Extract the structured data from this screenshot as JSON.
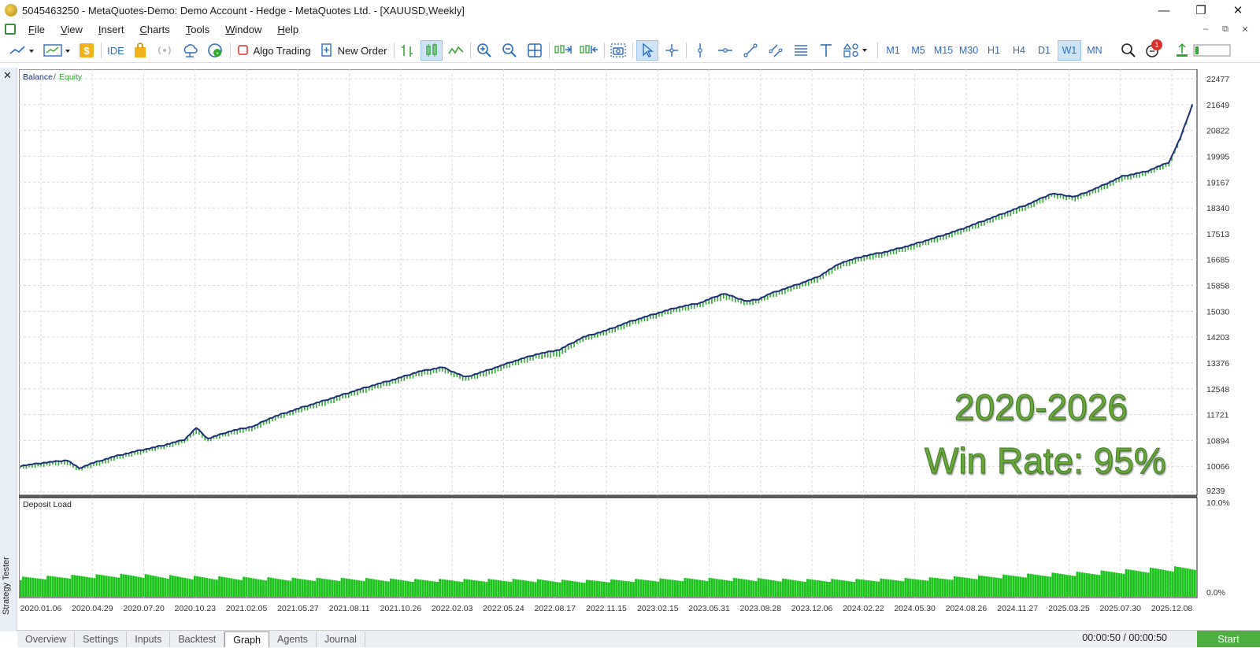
{
  "window": {
    "title": "5045463250 - MetaQuotes-Demo: Demo Account - Hedge - MetaQuotes Ltd. - [XAUUSD,Weekly]",
    "minimize": "—",
    "maximize": "❐",
    "close": "✕"
  },
  "menu": {
    "items": [
      "File",
      "View",
      "Insert",
      "Charts",
      "Tools",
      "Window",
      "Help"
    ],
    "mdi_minimize": "–",
    "mdi_restore": "⧉",
    "mdi_close": "✕"
  },
  "toolbar": {
    "ide_label": "IDE",
    "algo_trading_label": "Algo Trading",
    "new_order_label": "New Order",
    "timeframes": [
      "M1",
      "M5",
      "M15",
      "M30",
      "H1",
      "H4",
      "D1",
      "W1",
      "MN"
    ],
    "selected_timeframe": "W1",
    "notification_count": "1"
  },
  "panel": {
    "close_label": "✕",
    "side_label": "Strategy Tester",
    "overlay_line1": "2020-2026",
    "overlay_line2": "Win Rate: 95%"
  },
  "chart_data": [
    {
      "type": "line",
      "legend": [
        {
          "name": "Balance",
          "color": "#1c2f7a"
        },
        {
          "name": "Equity",
          "color": "#2fa82f"
        }
      ],
      "legend_separator": "/",
      "ylim": [
        9239,
        22477
      ],
      "y_ticks": [
        "22477",
        "21649",
        "20822",
        "19995",
        "19167",
        "18340",
        "17513",
        "16685",
        "15858",
        "15030",
        "14203",
        "13376",
        "12548",
        "11721",
        "10894",
        "10066",
        "9239"
      ],
      "x_ticks": [
        "2020.01.06",
        "2020.04.29",
        "2020.07.20",
        "2020.10.23",
        "2021.02.05",
        "2021.05.27",
        "2021.08.11",
        "2021.10.26",
        "2022.02.03",
        "2022.05.24",
        "2022.08.17",
        "2022.11.15",
        "2023.02.15",
        "2023.05.31",
        "2023.08.28",
        "2023.12.06",
        "2024.02.22",
        "2024.05.30",
        "2024.08.26",
        "2024.11.27",
        "2025.03.25",
        "2025.07.30",
        "2025.12.08"
      ],
      "series": [
        {
          "name": "Balance",
          "x": [
            0,
            2,
            4,
            5,
            6,
            8,
            10,
            12,
            14,
            15,
            16,
            17,
            18,
            20,
            21,
            22,
            24,
            26,
            28,
            30,
            32,
            34,
            36,
            38,
            40,
            42,
            44,
            46,
            48,
            50,
            52,
            54,
            56,
            58,
            60,
            62,
            63,
            64,
            66,
            68,
            69,
            70,
            72,
            74,
            76,
            78,
            80,
            82,
            84,
            86,
            88,
            90,
            92,
            94,
            96,
            98,
            99,
            100
          ],
          "values": [
            10080,
            10180,
            10260,
            10000,
            10150,
            10380,
            10560,
            10720,
            10920,
            11300,
            10950,
            11080,
            11200,
            11360,
            11560,
            11700,
            11950,
            12180,
            12420,
            12650,
            12860,
            13100,
            13240,
            12920,
            13160,
            13420,
            13650,
            13800,
            14200,
            14420,
            14700,
            14930,
            15150,
            15300,
            15600,
            15350,
            15420,
            15600,
            15850,
            16120,
            16350,
            16580,
            16800,
            16950,
            17150,
            17380,
            17620,
            17900,
            18180,
            18460,
            18800,
            18700,
            19000,
            19350,
            19500,
            19800,
            20600,
            21649
          ]
        },
        {
          "name": "Equity",
          "x": [
            0,
            2,
            4,
            5,
            6,
            8,
            10,
            12,
            14,
            15,
            16,
            17,
            18,
            20,
            21,
            22,
            24,
            26,
            28,
            30,
            32,
            34,
            36,
            38,
            40,
            42,
            44,
            46,
            48,
            50,
            52,
            54,
            56,
            58,
            60,
            62,
            63,
            64,
            66,
            68,
            69,
            70,
            72,
            74,
            76,
            78,
            80,
            82,
            84,
            86,
            88,
            90,
            92,
            94,
            96,
            98,
            99,
            100
          ],
          "values": [
            10000,
            10100,
            10150,
            9950,
            10050,
            10280,
            10470,
            10640,
            10830,
            11150,
            10880,
            11000,
            11100,
            11250,
            11450,
            11600,
            11850,
            12050,
            12300,
            12530,
            12750,
            12980,
            13120,
            12820,
            13020,
            13300,
            13520,
            13620,
            14100,
            14300,
            14580,
            14820,
            15030,
            15180,
            15450,
            15250,
            15320,
            15480,
            15730,
            16000,
            16220,
            16450,
            16680,
            16830,
            17030,
            17260,
            17500,
            17780,
            18060,
            18330,
            18700,
            18600,
            18880,
            19230,
            19400,
            19700,
            20500,
            21600
          ]
        }
      ]
    },
    {
      "type": "bar",
      "title": "Deposit Load",
      "ylim": [
        0,
        10
      ],
      "y_ticks": [
        "10.0%",
        "0.0%"
      ],
      "levels_percent": [
        1.9,
        2.1,
        2.2,
        2.0,
        1.9,
        1.8,
        1.8,
        1.7,
        1.7,
        1.7,
        1.6,
        1.7,
        1.8,
        1.8,
        1.7,
        1.7,
        1.8,
        2.0,
        2.2,
        2.4,
        2.7,
        3.0
      ]
    }
  ]
}
